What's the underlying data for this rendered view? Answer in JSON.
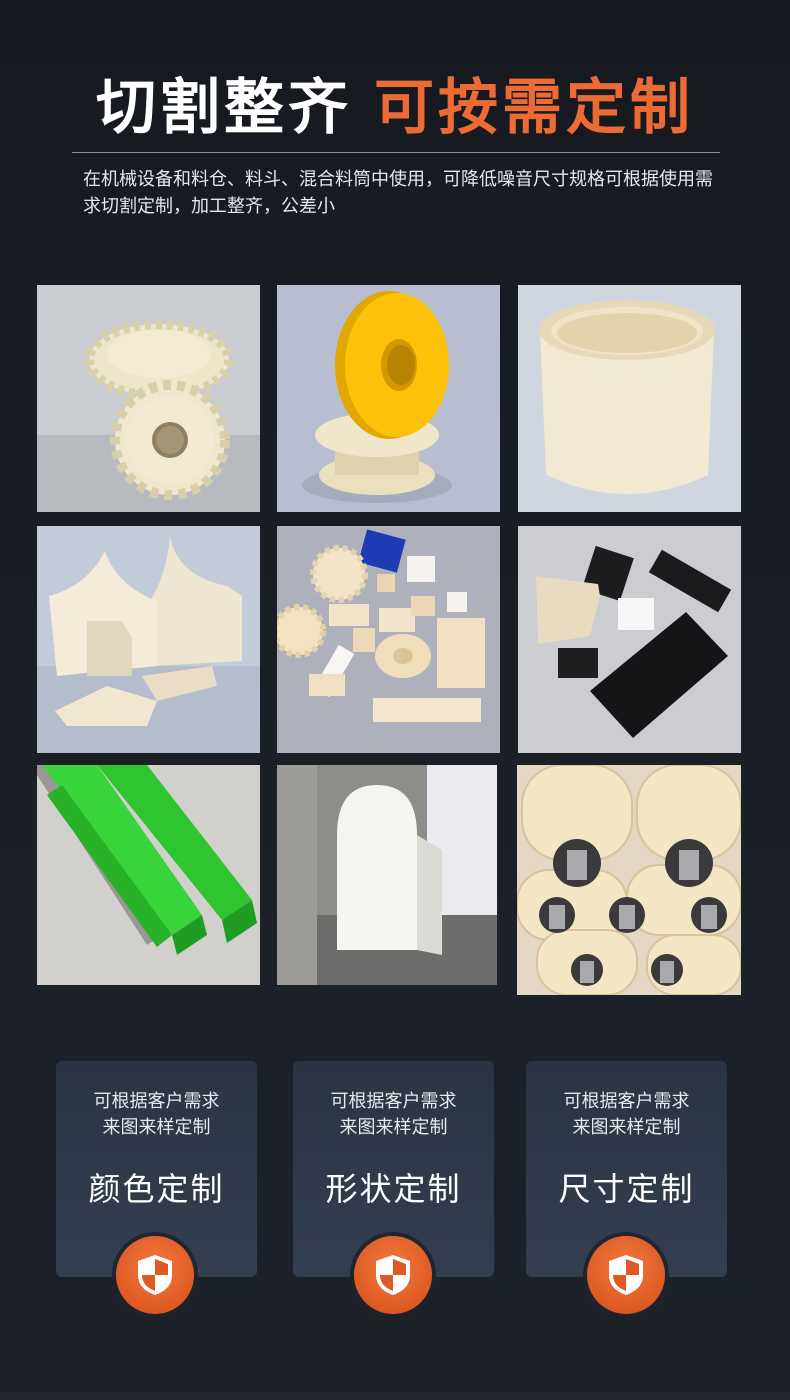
{
  "header": {
    "title_white": "切割整齐",
    "title_orange": "可按需定制",
    "description": "在机械设备和料仓、料斗、混合料筒中使用，可降低噪音尺寸规格可根据使用需求切割定制，加工整齐，公差小"
  },
  "colors": {
    "accent": "#ec6b34",
    "background": "#1a1e25",
    "card": "#2f3947"
  },
  "gallery": [
    {
      "name": "nylon-helical-gears-photo"
    },
    {
      "name": "yellow-white-pulley-photo"
    },
    {
      "name": "nylon-sleeve-cylinder-photo"
    },
    {
      "name": "curved-nylon-plates-photo"
    },
    {
      "name": "assorted-machined-parts-photo"
    },
    {
      "name": "black-and-white-blocks-photo"
    },
    {
      "name": "green-guide-rails-photo"
    },
    {
      "name": "white-arch-block-photo"
    },
    {
      "name": "nylon-rollers-photo"
    }
  ],
  "features": [
    {
      "line1": "可根据客户需求",
      "line2": "来图来样定制",
      "title": "颜色定制",
      "icon": "shield-icon"
    },
    {
      "line1": "可根据客户需求",
      "line2": "来图来样定制",
      "title": "形状定制",
      "icon": "shield-icon"
    },
    {
      "line1": "可根据客户需求",
      "line2": "来图来样定制",
      "title": "尺寸定制",
      "icon": "shield-icon"
    }
  ]
}
